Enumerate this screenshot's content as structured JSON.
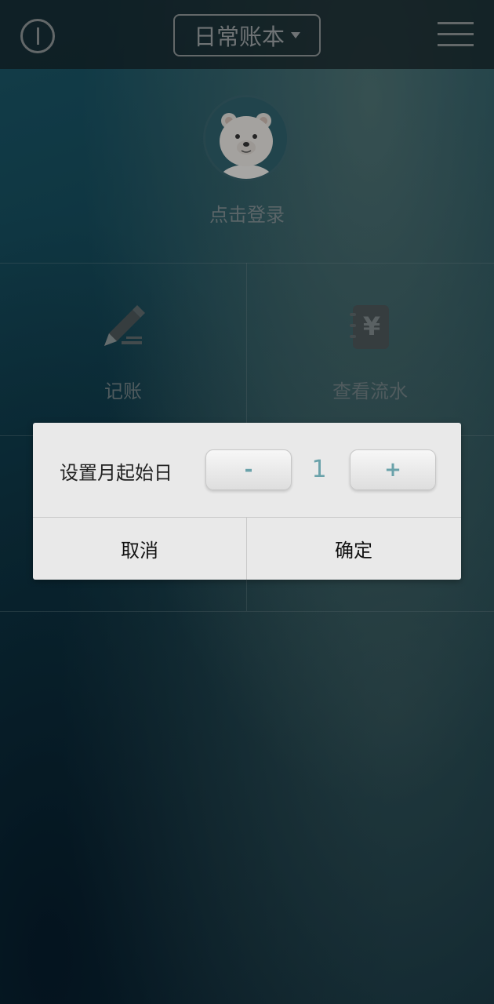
{
  "header": {
    "book_name": "日常账本"
  },
  "profile": {
    "login_label": "点击登录"
  },
  "tiles": [
    {
      "label": "记账",
      "icon": "pencil-icon"
    },
    {
      "label": "查看流水",
      "icon": "ledger-yen-icon"
    }
  ],
  "dialog": {
    "title": "设置月起始日",
    "minus_label": "-",
    "plus_label": "+",
    "value": "1",
    "cancel_label": "取消",
    "confirm_label": "确定"
  },
  "colors": {
    "accent": "#6aa2aa",
    "dialog_bg": "#e9e9e9"
  }
}
